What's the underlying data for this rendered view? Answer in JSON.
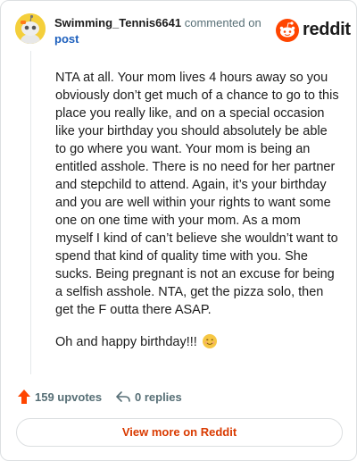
{
  "header": {
    "username": "Swimming_Tennis6641",
    "action_text": "commented on",
    "post_link": "post",
    "brand": "reddit"
  },
  "comment": {
    "paragraphs": [
      "NTA at all. Your mom lives 4 hours away so you obviously don’t get much of a chance to go to this place you really like, and on a special occasion like your birthday you should absolutely be able to go where you want. Your mom is being an entitled asshole. There is no need for her partner and stepchild to attend. Again, it’s your birthday and you are well within your rights to want some one on one time with your mom. As a mom myself I kind of can’t believe she wouldn’t want to spend that kind of quality time with you. She sucks. Being pregnant is not an excuse for being a selfish asshole. NTA, get the pizza solo, then get the F outta there ASAP.",
      "Oh and happy birthday!!!"
    ]
  },
  "footer": {
    "upvotes": "159 upvotes",
    "replies": "0 replies",
    "view_more": "View more on Reddit"
  },
  "colors": {
    "brand_orange": "#ff4500",
    "link_blue": "#1c5fbd",
    "view_more": "#d93a00",
    "muted": "#576f76"
  },
  "icons": [
    "avatar-snoo-icon",
    "reddit-logo-icon",
    "upvote-arrow-icon",
    "reply-arrow-icon",
    "smiling-face-emoji"
  ]
}
